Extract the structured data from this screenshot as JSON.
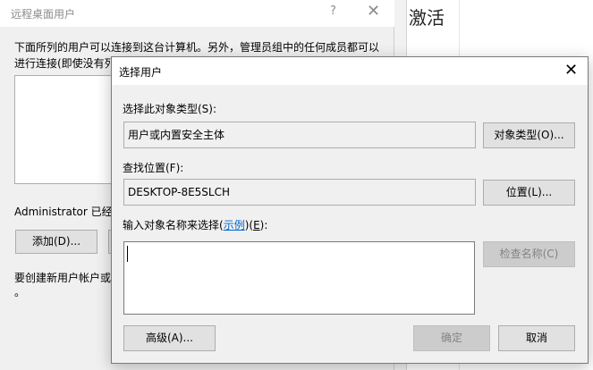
{
  "background": {
    "activate_text": "激活"
  },
  "back_dialog": {
    "title": "远程桌面用户",
    "help_glyph": "?",
    "close_glyph": "✕",
    "description_line1": "下面所列的用户可以连接到这台计算机。另外，管理员组中的任何成员都可以",
    "description_line2": "进行连接(即使没有列",
    "admin_text": "Administrator 已经",
    "add_button": "添加(D)...",
    "create_text": "要创建新用户帐户或",
    "dot_text": "。"
  },
  "front_dialog": {
    "title": "选择用户",
    "close_glyph": "✕",
    "object_type_label": "选择此对象类型(S):",
    "object_type_value": "用户或内置安全主体",
    "object_type_button": "对象类型(O)...",
    "location_label": "查找位置(F):",
    "location_value": "DESKTOP-8E5SLCH",
    "location_button": "位置(L)...",
    "enter_names_label_prefix": "输入对象名称来选择(",
    "enter_names_link": "示例",
    "enter_names_label_suffix_a": ")(",
    "enter_names_label_suffix_key": "E",
    "enter_names_label_suffix_b": "):",
    "check_names_button": "检查名称(C)",
    "advanced_button": "高级(A)...",
    "ok_button": "确定",
    "cancel_button": "取消"
  },
  "colors": {
    "dialog_bg": "#f0f0f0",
    "button_bg": "#e1e1e1",
    "border": "#adadad",
    "link": "#0066cc",
    "disabled_text": "#838383"
  }
}
